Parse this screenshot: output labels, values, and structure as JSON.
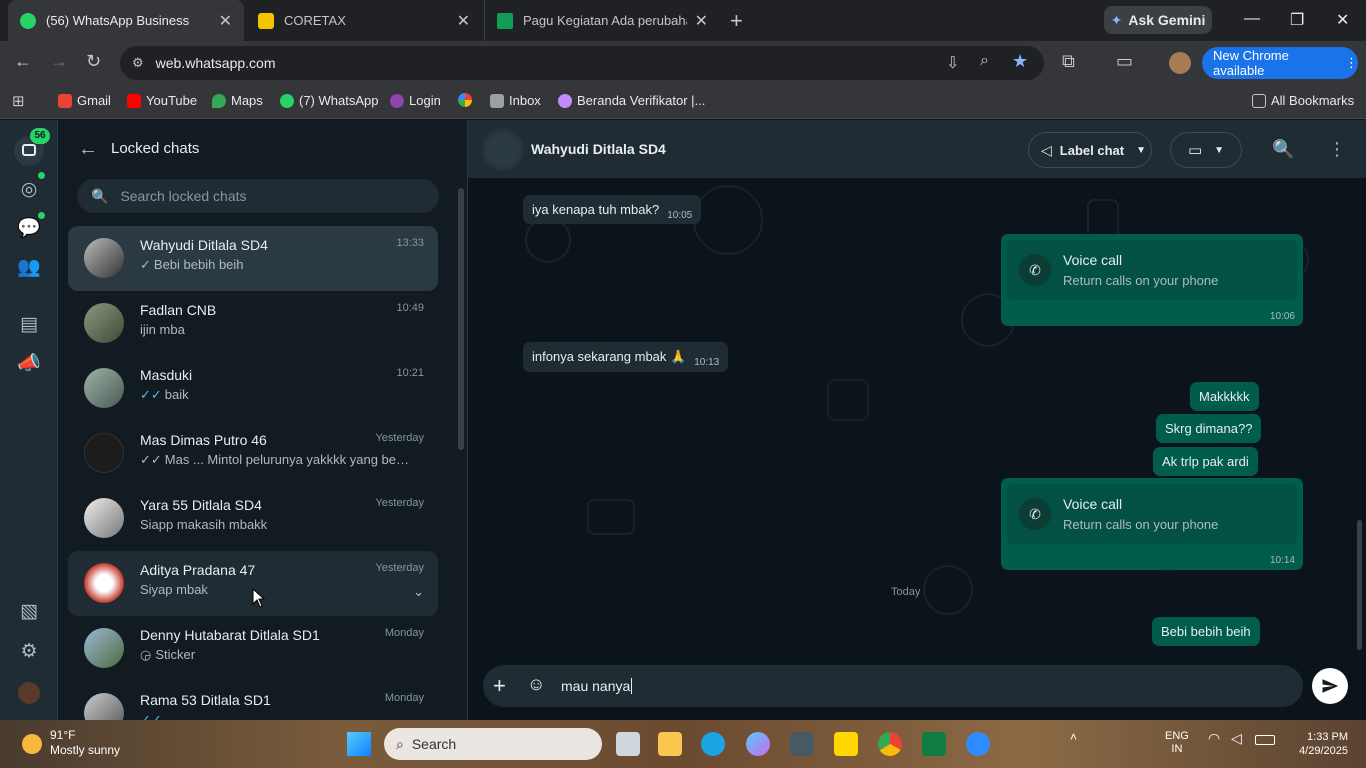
{
  "browser": {
    "tabs": [
      {
        "label": "(56) WhatsApp Business",
        "active": true
      },
      {
        "label": "CORETAX",
        "active": false
      },
      {
        "label": "Pagu Kegiatan Ada perubahan",
        "active": false
      }
    ],
    "ask_gemini": "Ask Gemini",
    "url": "web.whatsapp.com",
    "new_chrome": "New Chrome available",
    "bookmarks": [
      "Gmail",
      "YouTube",
      "Maps",
      "(7) WhatsApp",
      "Login",
      "Inbox",
      "Beranda Verifikator |..."
    ],
    "all_bookmarks": "All Bookmarks"
  },
  "rail": {
    "badge": "56",
    "icons": [
      "chats-icon",
      "status-icon",
      "channels-icon",
      "communities-icon",
      "catalog-icon",
      "ads-icon",
      "media-icon",
      "settings-icon",
      "profile-avatar"
    ]
  },
  "sidebar": {
    "title": "Locked chats",
    "search_placeholder": "Search locked chats",
    "chats": [
      {
        "name": "Wahyudi Ditlala SD4",
        "time": "13:33",
        "msg": "Bebi bebih beih",
        "tick": "✓"
      },
      {
        "name": "Fadlan CNB",
        "time": "10:49",
        "msg": "ijin mba",
        "tick": ""
      },
      {
        "name": "Masduki",
        "time": "10:21",
        "msg": "baik",
        "tick": "✓✓"
      },
      {
        "name": "Mas Dimas Putro 46",
        "time": "Yesterday",
        "msg": "Mas ... Mintol pelurunya yakkkk yang belu...",
        "tick": "✓✓"
      },
      {
        "name": "Yara 55 Ditlala SD4",
        "time": "Yesterday",
        "msg": "Siapp makasih mbakk",
        "tick": ""
      },
      {
        "name": "Aditya Pradana 47",
        "time": "Yesterday",
        "msg": "Siyap mbak",
        "tick": ""
      },
      {
        "name": "Denny Hutabarat Ditlala SD1",
        "time": "Monday",
        "msg": "Sticker",
        "tick": ""
      },
      {
        "name": "Rama 53 Ditlala SD1",
        "time": "Monday",
        "msg": "...",
        "tick": "✓✓"
      }
    ]
  },
  "conversation": {
    "contact": "Wahyudi Ditlala SD4",
    "label_chat": "Label chat",
    "messages": {
      "m1": {
        "text": "iya kenapa tuh mbak?",
        "time": "10:05"
      },
      "call1": {
        "title": "Voice call",
        "sub": "Return calls on your phone",
        "time": "10:06"
      },
      "m2": {
        "text": "infonya sekarang mbak 🙏",
        "time": "10:13"
      },
      "m3": {
        "text": "Makkkkk"
      },
      "m4": {
        "text": "Skrg dimana??"
      },
      "m5": {
        "text": "Ak trlp pak ardi"
      },
      "call2": {
        "title": "Voice call",
        "sub": "Return calls on your phone",
        "time": "10:14"
      },
      "m6": {
        "text": "Bebi bebih beih"
      }
    },
    "date_divider": "Today",
    "composer_text": "mau nanya"
  },
  "taskbar": {
    "temp": "91°F",
    "weather": "Mostly sunny",
    "search": "Search",
    "lang": "ENG",
    "region": "IN",
    "time": "1:33 PM",
    "date": "4/29/2025"
  },
  "colors": {
    "wa_green": "#25d366",
    "outgoing": "#005c4b",
    "incoming": "#202c33",
    "chrome_blue": "#1a73e8"
  }
}
